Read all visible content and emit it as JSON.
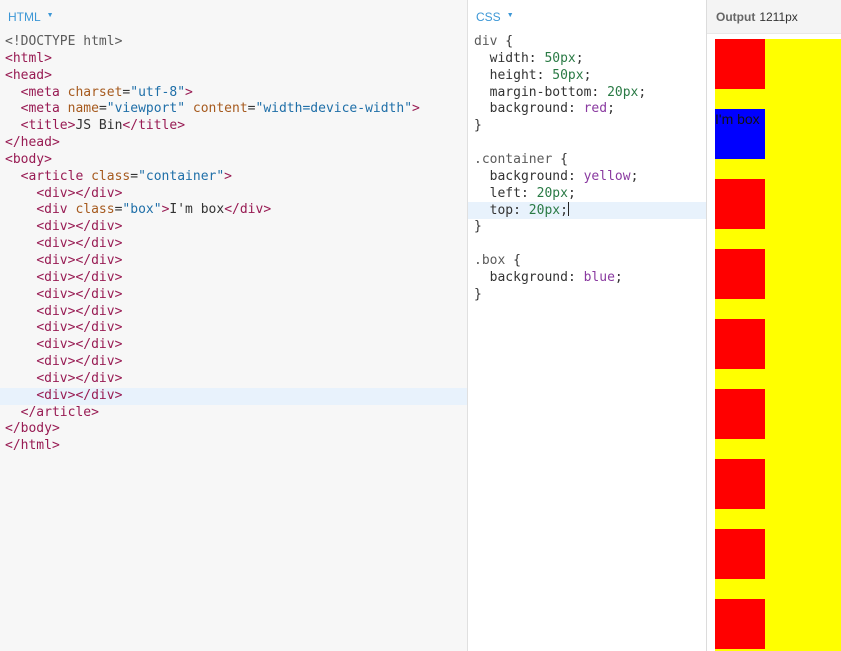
{
  "html_panel": {
    "tab_label": "HTML",
    "lines": [
      "<!DOCTYPE html>",
      "<html>",
      "<head>",
      "  <meta charset=\"utf-8\">",
      "  <meta name=\"viewport\" content=\"width=device-width\">",
      "  <title>JS Bin</title>",
      "</head>",
      "<body>",
      "  <article class=\"container\">",
      "    <div></div>",
      "    <div class=\"box\">I'm box</div>",
      "    <div></div>",
      "    <div></div>",
      "    <div></div>",
      "    <div></div>",
      "    <div></div>",
      "    <div></div>",
      "    <div></div>",
      "    <div></div>",
      "    <div></div>",
      "    <div></div>",
      "    <div></div>",
      "  </article>",
      "</body>",
      "</html>"
    ],
    "active_line": 21
  },
  "css_panel": {
    "tab_label": "CSS",
    "lines": [
      "div {",
      "  width: 50px;",
      "  height: 50px;",
      "  margin-bottom: 20px;",
      "  background: red;",
      "}",
      "",
      ".container {",
      "  background: yellow;",
      "  left: 20px;",
      "  top: 20px;",
      "}",
      "",
      ".box {",
      "  background: blue;",
      "}"
    ],
    "active_line": 10
  },
  "output_panel": {
    "label": "Output",
    "width_text": "1211px",
    "box_text": "I'm box",
    "container_color": "#ffff00",
    "div_color": "#ff0000",
    "box_color": "#0000ff",
    "visible_div_count": 9
  }
}
